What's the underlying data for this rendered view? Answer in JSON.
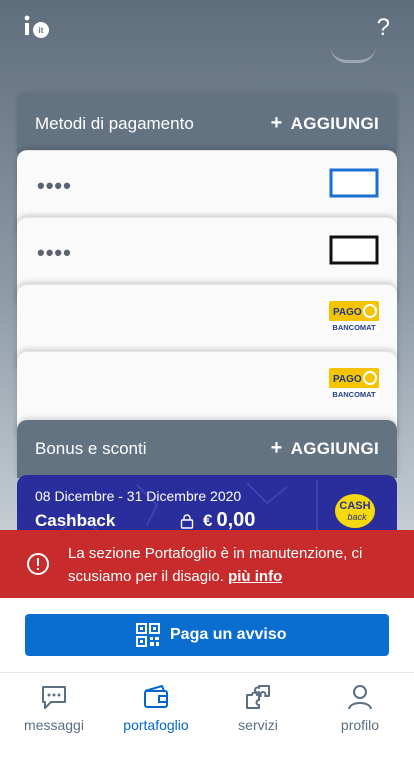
{
  "header": {
    "logo_text": "io",
    "logo_badge": "it",
    "help_label": "?"
  },
  "payment_methods": {
    "title": "Metodi di pagamento",
    "add_label": "AGGIUNGI",
    "cards": [
      {
        "masked": "••••",
        "brand_icon": "blue-card-icon"
      },
      {
        "masked": "••••",
        "brand_icon": "black-card-icon"
      },
      {
        "masked": "",
        "brand_icon": "pagobancomat-logo",
        "brand_top": "PAGO",
        "brand_bottom": "BANCOMAT"
      },
      {
        "masked": "",
        "brand_icon": "pagobancomat-logo",
        "brand_top": "PAGO",
        "brand_bottom": "BANCOMAT"
      }
    ]
  },
  "bonus": {
    "title": "Bonus e sconti",
    "add_label": "AGGIUNGI",
    "cashback": {
      "period": "08 Dicembre - 31 Dicembre 2020",
      "name": "Cashback",
      "currency": "€",
      "amount": "0,00",
      "logo_top": "CASH",
      "logo_bottom": "back"
    }
  },
  "banner": {
    "message": "La sezione Portafoglio è in manutenzione, ci scusiamo per il disagio.",
    "more_link": "più info",
    "color": "#c72b2b"
  },
  "pay_button": {
    "label": "Paga un avviso",
    "color": "#0a6ed1"
  },
  "tabs": [
    {
      "label": "messaggi",
      "icon": "chat-icon",
      "active": false
    },
    {
      "label": "portafoglio",
      "icon": "wallet-icon",
      "active": true
    },
    {
      "label": "servizi",
      "icon": "puzzle-icon",
      "active": false
    },
    {
      "label": "profilo",
      "icon": "user-icon",
      "active": false
    }
  ],
  "colors": {
    "accent": "#0066cc",
    "header_bg": "#637382",
    "cashback_bg": "#2a2e9c"
  }
}
